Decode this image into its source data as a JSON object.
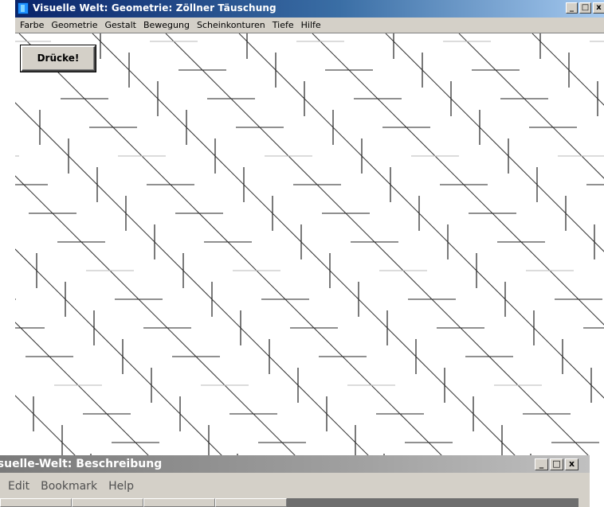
{
  "main_window": {
    "title": "Visuelle Welt: Geometrie: Zöllner Täuschung",
    "controls": {
      "minimize": "_",
      "maximize": "□",
      "close": "x"
    },
    "menu": [
      "Farbe",
      "Geometrie",
      "Gestalt",
      "Bewegung",
      "Scheinkonturen",
      "Tiefe",
      "Hilfe"
    ],
    "button_label": "Drücke!",
    "illusion": "zoellner-illusion"
  },
  "description_window": {
    "title": "isuelle-Welt: Beschreibung",
    "controls": {
      "minimize": "_",
      "maximize": "□",
      "close": "x"
    },
    "menu": [
      "Edit",
      "Bookmark",
      "Help"
    ]
  }
}
